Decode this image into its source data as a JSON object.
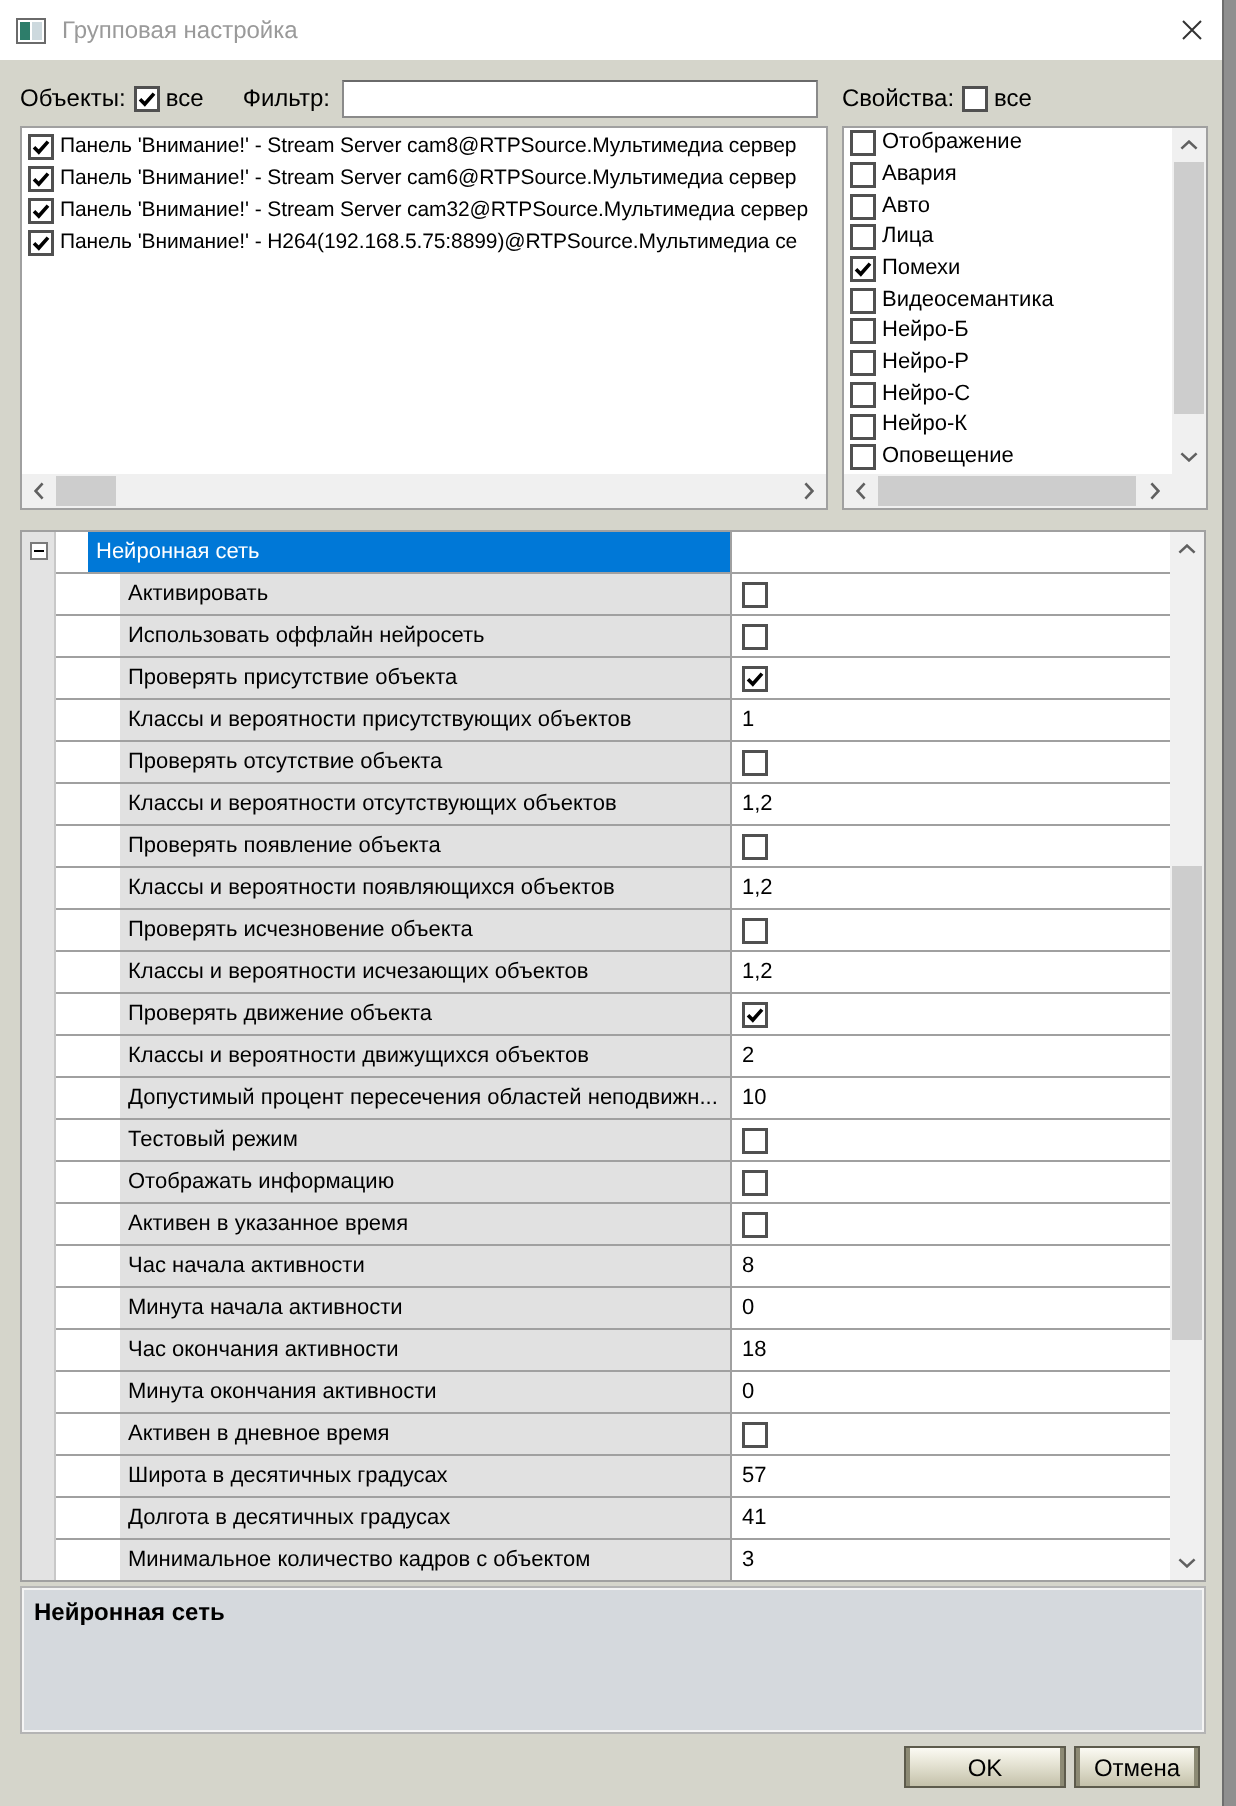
{
  "window": {
    "title": "Групповая настройка"
  },
  "objects": {
    "label": "Объекты:",
    "all_label": "все",
    "all_checked": true,
    "items": [
      {
        "label": "Панель 'Внимание!' - Stream Server cam8@RTPSource.Мультимедиа сервер",
        "checked": true
      },
      {
        "label": "Панель 'Внимание!' - Stream Server cam6@RTPSource.Мультимедиа сервер",
        "checked": true
      },
      {
        "label": "Панель 'Внимание!' - Stream Server cam32@RTPSource.Мультимедиа сервер",
        "checked": true
      },
      {
        "label": "Панель 'Внимание!' - H264(192.168.5.75:8899)@RTPSource.Мультимедиа се",
        "checked": true
      }
    ]
  },
  "filter": {
    "label": "Фильтр:"
  },
  "properties": {
    "label": "Свойства:",
    "all_label": "все",
    "all_checked": false,
    "items": [
      {
        "label": "Отображение",
        "checked": false
      },
      {
        "label": "Авария",
        "checked": false
      },
      {
        "label": "Авто",
        "checked": false
      },
      {
        "label": "Лица",
        "checked": false
      },
      {
        "label": "Помехи",
        "checked": true
      },
      {
        "label": "Видеосемантика",
        "checked": false
      },
      {
        "label": "Нейро-Б",
        "checked": false
      },
      {
        "label": "Нейро-Р",
        "checked": false
      },
      {
        "label": "Нейро-С",
        "checked": false
      },
      {
        "label": "Нейро-К",
        "checked": false
      },
      {
        "label": "Оповещение",
        "checked": false
      }
    ]
  },
  "grid": {
    "category": {
      "label": "Нейронная сеть",
      "expanded": true,
      "selected": true
    },
    "rows": [
      {
        "label": "Активировать",
        "kind": "checkbox",
        "checked": false
      },
      {
        "label": "Использовать оффлайн нейросеть",
        "kind": "checkbox",
        "checked": false
      },
      {
        "label": "Проверять присутствие объекта",
        "kind": "checkbox",
        "checked": true
      },
      {
        "label": "Классы и вероятности присутствующих объектов",
        "kind": "text",
        "value": "1"
      },
      {
        "label": "Проверять отсутствие объекта",
        "kind": "checkbox",
        "checked": false
      },
      {
        "label": "Классы и вероятности отсутствующих объектов",
        "kind": "text",
        "value": "1,2"
      },
      {
        "label": "Проверять появление объекта",
        "kind": "checkbox",
        "checked": false
      },
      {
        "label": "Классы и вероятности появляющихся объектов",
        "kind": "text",
        "value": "1,2"
      },
      {
        "label": "Проверять исчезновение объекта",
        "kind": "checkbox",
        "checked": false
      },
      {
        "label": "Классы и вероятности исчезающих объектов",
        "kind": "text",
        "value": "1,2"
      },
      {
        "label": "Проверять движение объекта",
        "kind": "checkbox",
        "checked": true
      },
      {
        "label": "Классы и вероятности движущихся объектов",
        "kind": "text",
        "value": "2"
      },
      {
        "label": "Допустимый процент пересечения областей неподвижн...",
        "kind": "text",
        "value": "10"
      },
      {
        "label": "Тестовый режим",
        "kind": "checkbox",
        "checked": false
      },
      {
        "label": "Отображать информацию",
        "kind": "checkbox",
        "checked": false
      },
      {
        "label": "Активен в указанное время",
        "kind": "checkbox",
        "checked": false
      },
      {
        "label": "Час начала активности",
        "kind": "text",
        "value": "8"
      },
      {
        "label": "Минута начала активности",
        "kind": "text",
        "value": "0"
      },
      {
        "label": "Час окончания активности",
        "kind": "text",
        "value": "18"
      },
      {
        "label": "Минута окончания активности",
        "kind": "text",
        "value": "0"
      },
      {
        "label": "Активен в дневное время",
        "kind": "checkbox",
        "checked": false
      },
      {
        "label": "Широта в десятичных градусах",
        "kind": "text",
        "value": "57"
      },
      {
        "label": "Долгота в десятичных градусах",
        "kind": "text",
        "value": "41"
      },
      {
        "label": "Минимальное количество кадров с объектом",
        "kind": "text",
        "value": "3"
      }
    ]
  },
  "description": {
    "title": "Нейронная сеть"
  },
  "buttons": [
    {
      "label": "OK"
    },
    {
      "label": "Отмена"
    }
  ]
}
